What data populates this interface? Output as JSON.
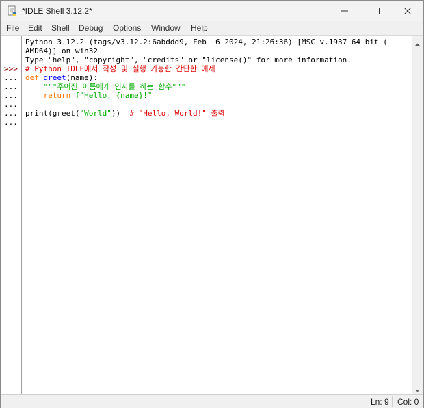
{
  "window": {
    "title": "*IDLE Shell 3.12.2*",
    "minimize_icon": "minimize-icon",
    "maximize_icon": "maximize-icon",
    "close_icon": "close-icon"
  },
  "menu": {
    "items": [
      "File",
      "Edit",
      "Shell",
      "Debug",
      "Options",
      "Window",
      "Help"
    ]
  },
  "shell": {
    "banner": [
      "Python 3.12.2 (tags/v3.12.2:6abddd9, Feb  6 2024, 21:26:36) [MSC v.1937 64 bit (",
      "AMD64)] on win32",
      "Type \"help\", \"copyright\", \"credits\" or \"license()\" for more information."
    ],
    "prompts": [
      ">>>",
      "...",
      "...",
      "...",
      "...",
      "...",
      "..."
    ],
    "code": {
      "line1_comment": "# Python IDLE에서 작성 및 실행 가능한 간단한 예제",
      "line2_kw": "def",
      "line2_name": "greet",
      "line2_rest": "(name):",
      "line3_indent": "    ",
      "line3_doc": "\"\"\"주어진 이름에게 인사를 하는 함수\"\"\"",
      "line4_indent": "    ",
      "line4_kw": "return",
      "line4_str": " f\"Hello, {name}!\"",
      "line6_call": "print(greet(",
      "line6_arg": "\"World\"",
      "line6_close": "))  ",
      "line6_comment": "# \"Hello, World!\" 출력"
    }
  },
  "status": {
    "ln": "Ln: 9",
    "col": "Col: 0"
  },
  "colors": {
    "keyword": "#ff7700",
    "definition": "#0000ff",
    "string": "#00aa00",
    "comment": "#dd0000",
    "prompt": "#8b0000"
  }
}
